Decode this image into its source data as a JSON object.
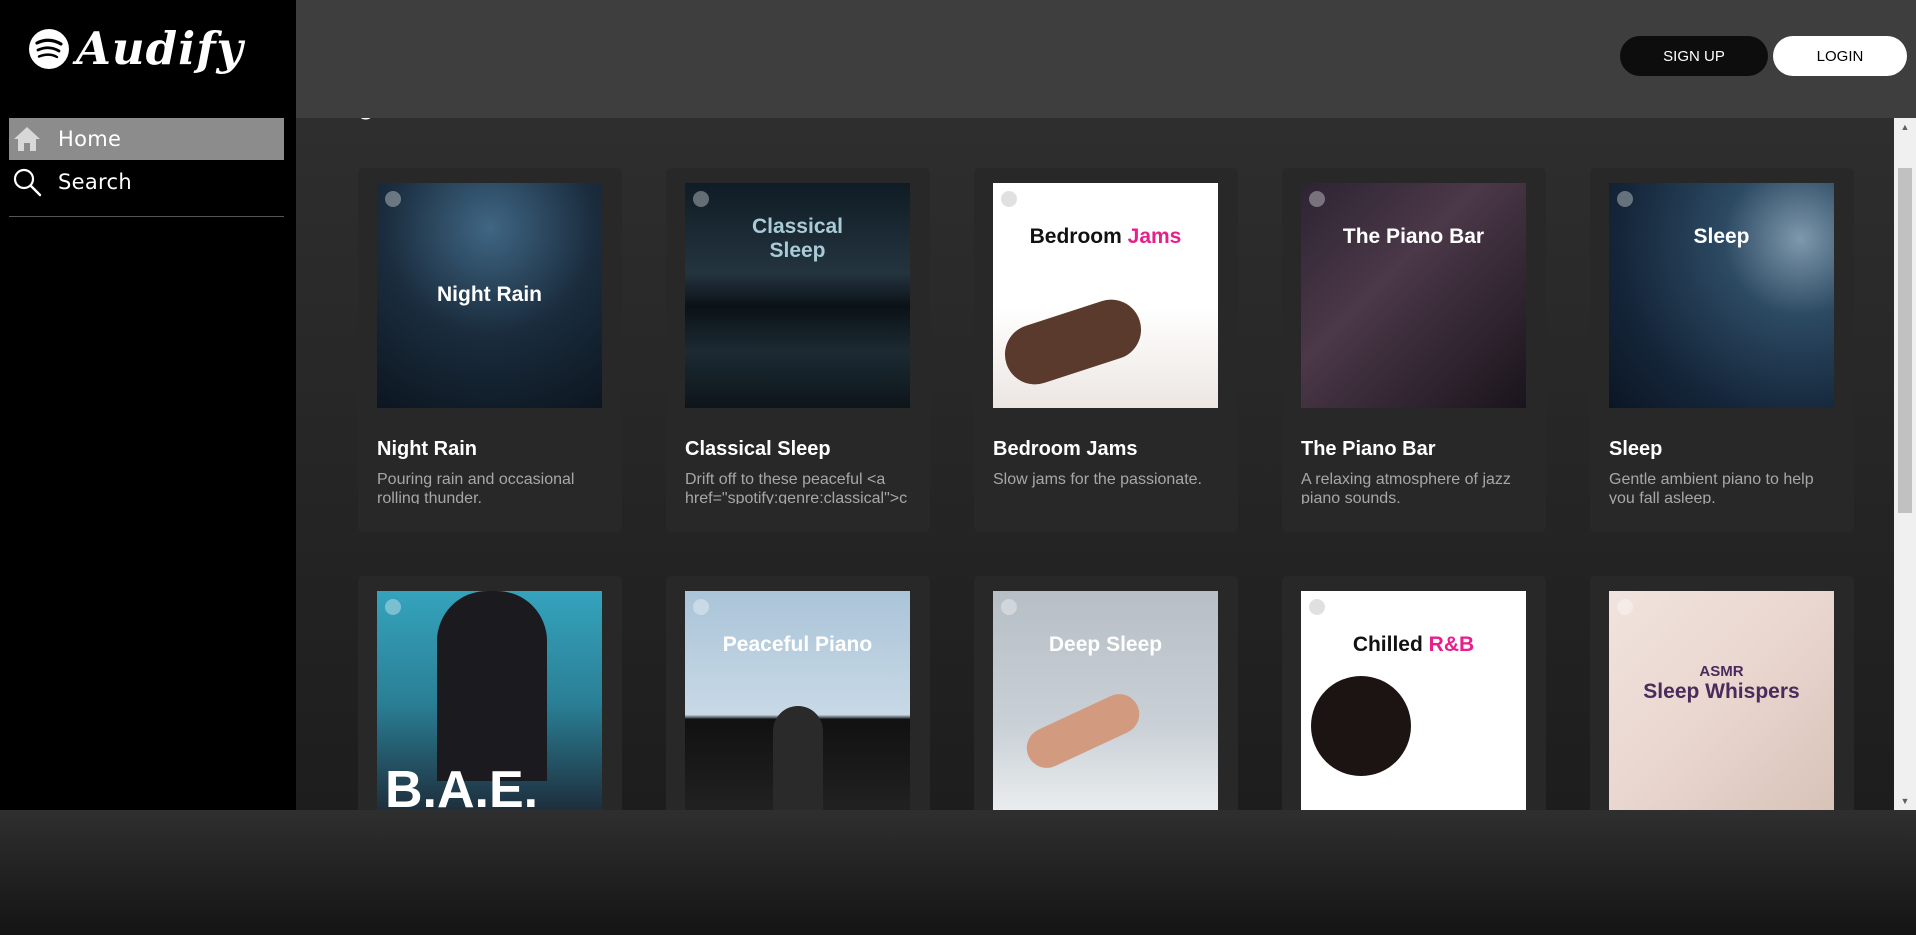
{
  "app": {
    "name": "Audify"
  },
  "sidebar": {
    "items": [
      {
        "label": "Home",
        "icon": "home-icon",
        "active": true
      },
      {
        "label": "Search",
        "icon": "search-icon",
        "active": false
      }
    ]
  },
  "header": {
    "signup_label": "SIGN UP",
    "login_label": "LOGIN"
  },
  "main": {
    "section_peek": "g",
    "cards": [
      {
        "title": "Night Rain",
        "description": "Pouring rain and occasional rolling thunder.",
        "cover_text": "Night Rain"
      },
      {
        "title": "Classical Sleep",
        "description": "Drift off to these peaceful <a href=\"spotify:genre:classical\">c",
        "cover_text": "Classical Sleep"
      },
      {
        "title": "Bedroom Jams",
        "description": "Slow jams for the passionate.",
        "cover_text_a": "Bedroom",
        "cover_text_b": "Jams"
      },
      {
        "title": "The Piano Bar",
        "description": "A relaxing atmosphere of jazz piano sounds.",
        "cover_text": "The Piano Bar"
      },
      {
        "title": "Sleep",
        "description": "Gentle ambient piano to help you fall asleep.",
        "cover_text": "Sleep"
      },
      {
        "title": "",
        "description": "",
        "cover_text": "B.A.E."
      },
      {
        "title": "",
        "description": "",
        "cover_text": "Peaceful Piano"
      },
      {
        "title": "",
        "description": "",
        "cover_text": "Deep Sleep"
      },
      {
        "title": "",
        "description": "",
        "cover_text_a": "Chilled",
        "cover_text_b": "R&B"
      },
      {
        "title": "",
        "description": "",
        "cover_text_small": "ASMR",
        "cover_text": "Sleep Whispers"
      }
    ]
  },
  "colors": {
    "sidebar_bg": "#000000",
    "header_bg": "#3e3e3e",
    "card_bg": "#282828",
    "accent_pink": "#e91e8c"
  }
}
